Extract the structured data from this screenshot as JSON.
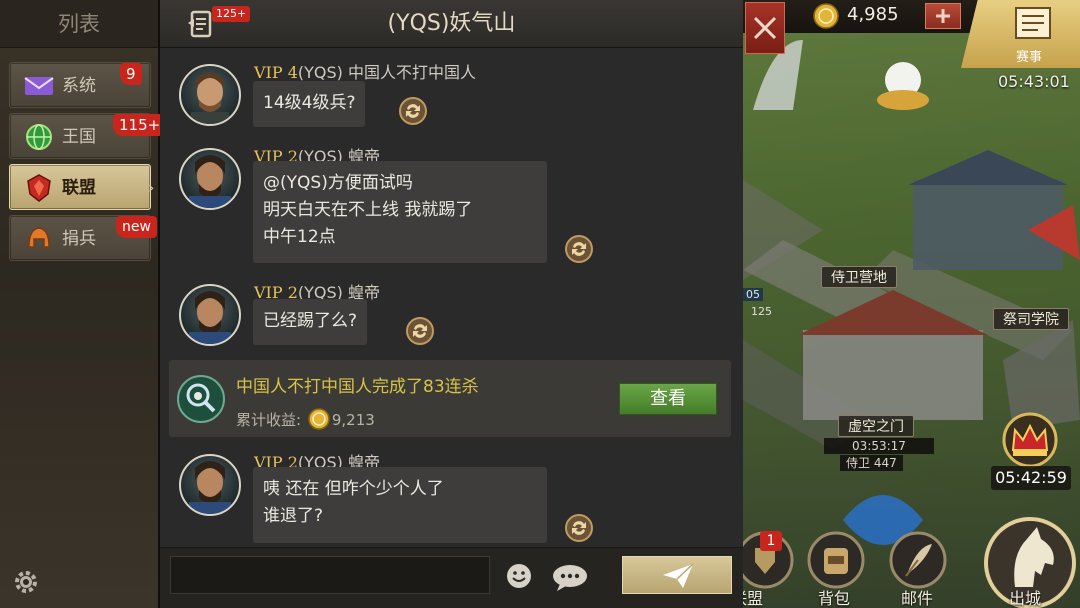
{
  "left_panel": {
    "title": "列表",
    "categories": [
      {
        "label": "系统",
        "badge": "9",
        "icon": "mail-icon"
      },
      {
        "label": "王国",
        "badge": "115+",
        "icon": "globe-icon"
      },
      {
        "label": "联盟",
        "badge": "",
        "icon": "alliance-crest-icon",
        "active": true
      },
      {
        "label": "捐兵",
        "badge": "new",
        "icon": "helmet-icon"
      }
    ],
    "settings_icon": "gear-icon"
  },
  "chat": {
    "title": "(YQS)妖气山",
    "history_badge": "125+",
    "messages": [
      {
        "vip": "VIP 4",
        "alliance": "(YQS)",
        "name": "中国人不打中国人",
        "text": "14级4级兵?"
      },
      {
        "vip": "VIP 2",
        "alliance": "(YQS)",
        "name": "蝗帝",
        "lines": [
          "@(YQS)方便面试吗",
          "明天白天在不上线 我就踢了",
          "中午12点"
        ]
      },
      {
        "vip": "VIP 2",
        "alliance": "(YQS)",
        "name": "蝗帝",
        "text": "已经踢了么?"
      },
      {
        "vip": "VIP 2",
        "alliance": "(YQS)",
        "name": "蝗帝",
        "lines": [
          "咦 还在 但咋个少个人了",
          "谁退了?"
        ]
      }
    ],
    "event": {
      "text": "中国人不打中国人完成了83连杀",
      "income_label": "累计收益:",
      "income_value": "9,213",
      "button": "查看"
    },
    "input_placeholder": ""
  },
  "game": {
    "gold": "4,985",
    "event_label": "赛事",
    "event_timer": "05:43:01",
    "map_labels": {
      "guard_camp": "侍卫营地",
      "priest_academy": "祭司学院",
      "void_gate": "虚空之门"
    },
    "gate_timer": "03:53:17",
    "guard_count": "侍卫 447",
    "crown_timer": "05:42:59",
    "bottom": {
      "alliance": "联盟",
      "alliance_badge": "1",
      "bag": "背包",
      "mail": "邮件",
      "exit_city": "出城"
    },
    "small_values": {
      "v1": "05",
      "v2": "125"
    }
  },
  "colors": {
    "vip_gold": "#e8c25a",
    "event_yellow": "#d6c348",
    "view_green": "#447c2a",
    "badge_red": "#c8261c"
  }
}
